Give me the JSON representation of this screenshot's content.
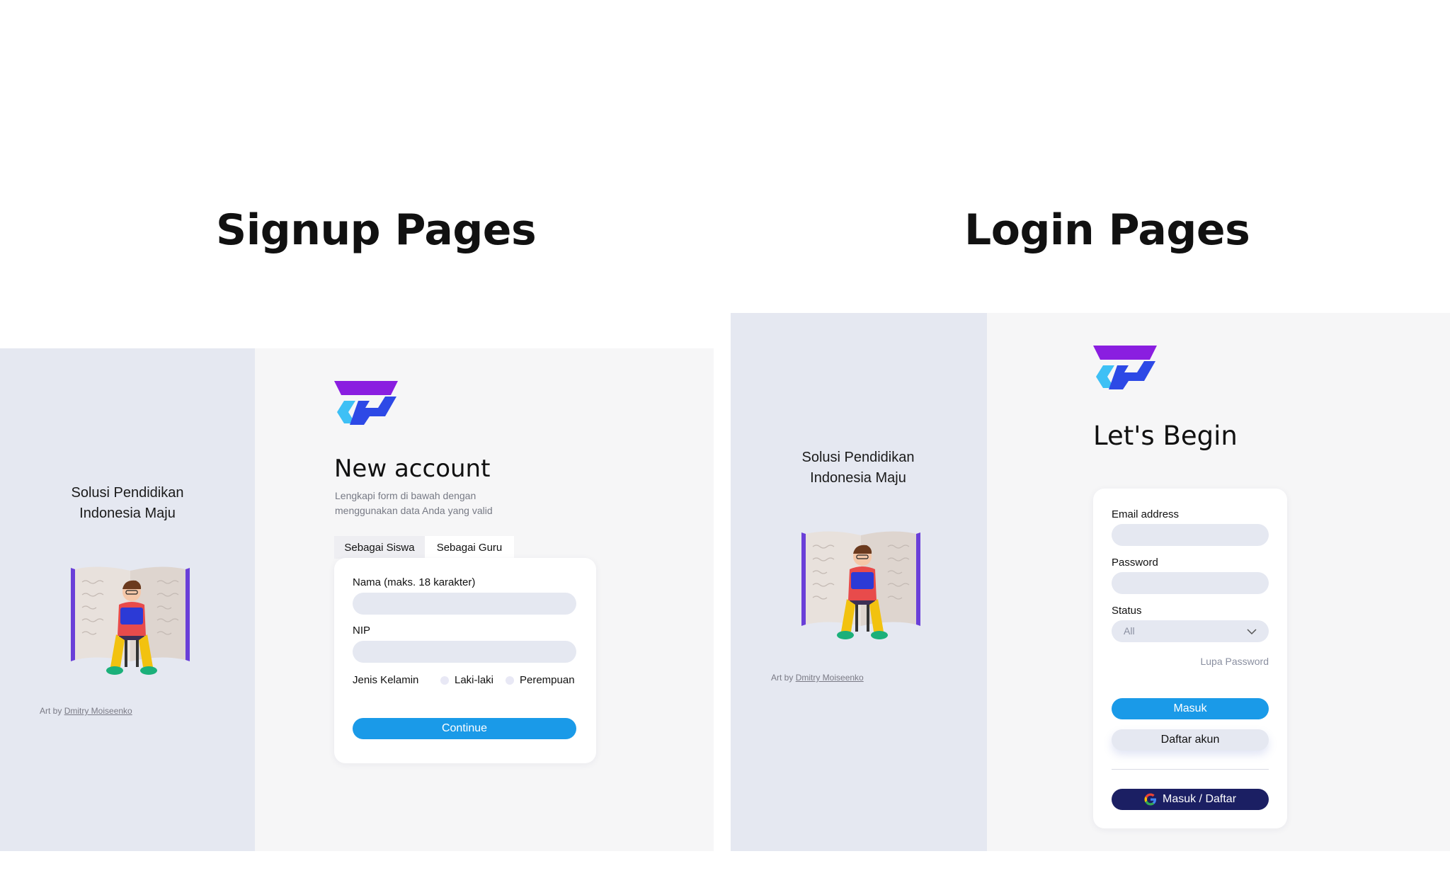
{
  "headings": {
    "signup": "Signup Pages",
    "login": "Login Pages"
  },
  "colors": {
    "primary": "#1a9ae8",
    "navy": "#1b1f63",
    "side_bg": "#e5e8f1",
    "panel_bg": "#f6f6f7",
    "logo_purple": "#8a1ee0",
    "logo_blue": "#2d49e6",
    "logo_cyan": "#3ec0f5"
  },
  "signup": {
    "tagline_line1": "Solusi Pendidikan",
    "tagline_line2": "Indonesia Maju",
    "credit_prefix": "Art by",
    "credit_name": "Dmitry Moiseenko",
    "title": "New account",
    "subtitle": "Lengkapi form di bawah dengan menggunakan data Anda yang valid",
    "tabs": [
      "Sebagai Siswa",
      "Sebagai Guru"
    ],
    "active_tab": "Sebagai Guru",
    "name_label": "Nama (maks. 18 karakter)",
    "nip_label": "NIP",
    "gender_label": "Jenis Kelamin",
    "gender_options": [
      "Laki-laki",
      "Perempuan"
    ],
    "continue_label": "Continue"
  },
  "login": {
    "tagline_line1": "Solusi Pendidikan",
    "tagline_line2": "Indonesia Maju",
    "credit_prefix": "Art by",
    "credit_name": "Dmitry Moiseenko",
    "title": "Let's Begin",
    "email_label": "Email address",
    "password_label": "Password",
    "status_label": "Status",
    "status_value": "All",
    "forgot_label": "Lupa Password",
    "masuk_label": "Masuk",
    "daftar_label": "Daftar akun",
    "google_label": "Masuk / Daftar",
    "google_icon": "google-g-icon"
  }
}
